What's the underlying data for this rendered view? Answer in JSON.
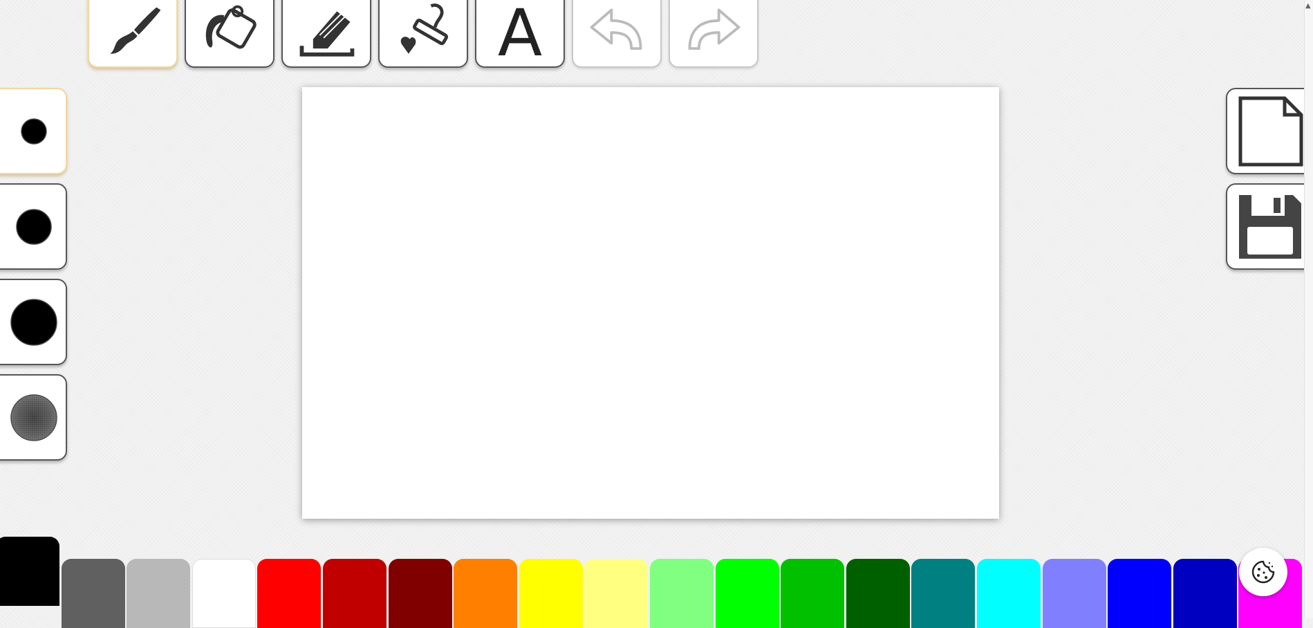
{
  "toolbar": {
    "tools": [
      {
        "id": "brush",
        "icon": "paintbrush-icon",
        "selected": true
      },
      {
        "id": "fill",
        "icon": "paint-bucket-icon",
        "selected": false
      },
      {
        "id": "eraser",
        "icon": "eraser-icon",
        "selected": false
      },
      {
        "id": "stamp",
        "icon": "stamp-icon",
        "selected": false
      },
      {
        "id": "text",
        "icon": "text-tool-icon",
        "label": "A",
        "selected": false
      },
      {
        "id": "undo",
        "icon": "undo-arrow-icon",
        "disabled": true
      },
      {
        "id": "redo",
        "icon": "redo-arrow-icon",
        "disabled": true
      }
    ]
  },
  "brush_sizes": [
    {
      "id": "small",
      "icon": "small-dot-icon",
      "selected": true
    },
    {
      "id": "medium",
      "icon": "medium-dot-icon",
      "selected": false
    },
    {
      "id": "large",
      "icon": "large-dot-icon",
      "selected": false
    },
    {
      "id": "spray",
      "icon": "spray-dot-icon",
      "selected": false
    }
  ],
  "actions": [
    {
      "id": "new",
      "icon": "new-page-icon"
    },
    {
      "id": "save",
      "icon": "floppy-disk-icon"
    }
  ],
  "palette": {
    "selected": "#000000",
    "colors": [
      "#000000",
      "#606060",
      "#b8b8b8",
      "#ffffff",
      "#ff0000",
      "#c00000",
      "#800000",
      "#ff8000",
      "#ffff00",
      "#ffff80",
      "#80ff80",
      "#00ff00",
      "#00c000",
      "#006000",
      "#008080",
      "#00ffff",
      "#8080ff",
      "#0000ff",
      "#0000c0",
      "#ff00ff"
    ]
  },
  "icons": {
    "cookie": "cookie-consent-icon"
  },
  "text_tool": {
    "letter": "A"
  }
}
